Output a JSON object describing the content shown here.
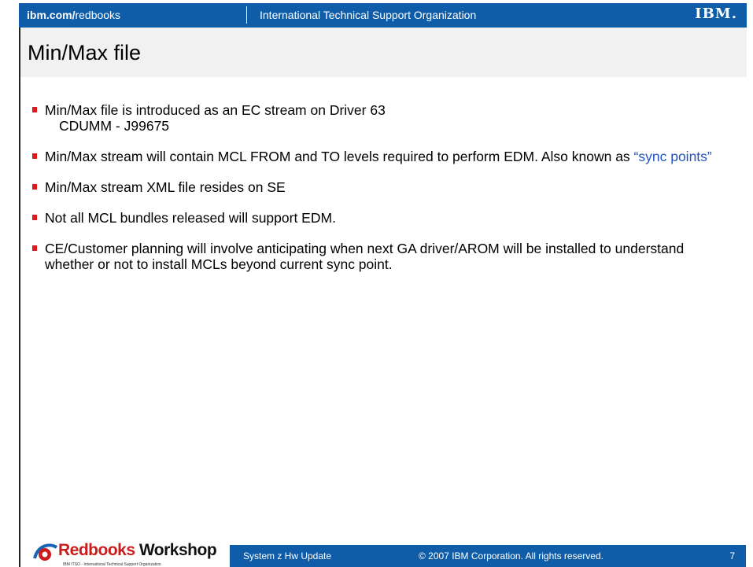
{
  "header": {
    "site_bold": "ibm.com/",
    "site_rest": "redbooks",
    "org": "International Technical Support Organization",
    "logo": "IBM."
  },
  "slide": {
    "title": "Min/Max file",
    "bullets": [
      {
        "text": "Min/Max file is introduced as an EC stream on Driver 63",
        "sub": "CDUMM  -  J99675"
      },
      {
        "text": "Min/Max stream will contain MCL FROM  and TO levels required to perform EDM. Also known as ",
        "highlight": "“sync points”"
      },
      {
        "text": "Min/Max stream XML file resides on SE"
      },
      {
        "text": "Not all MCL bundles released will support EDM."
      },
      {
        "text": "CE/Customer planning will involve anticipating when next GA driver/AROM will be installed to understand whether or not to install MCLs beyond current sync point."
      }
    ]
  },
  "footer": {
    "brand_red": "Redbooks",
    "brand_black": "Workshop",
    "brand_sub": "IBM ITSO - International Technical Support Organization",
    "course": "System z Hw Update",
    "copyright": "© 2007 IBM Corporation. All rights reserved.",
    "page": "7"
  },
  "colors": {
    "bar_blue": "#0f5ca8",
    "bullet_red": "#e01a1a",
    "link_blue": "#2154c5"
  },
  "icons": [
    "ibm-logo-icon",
    "redbooks-swoosh-icon"
  ]
}
